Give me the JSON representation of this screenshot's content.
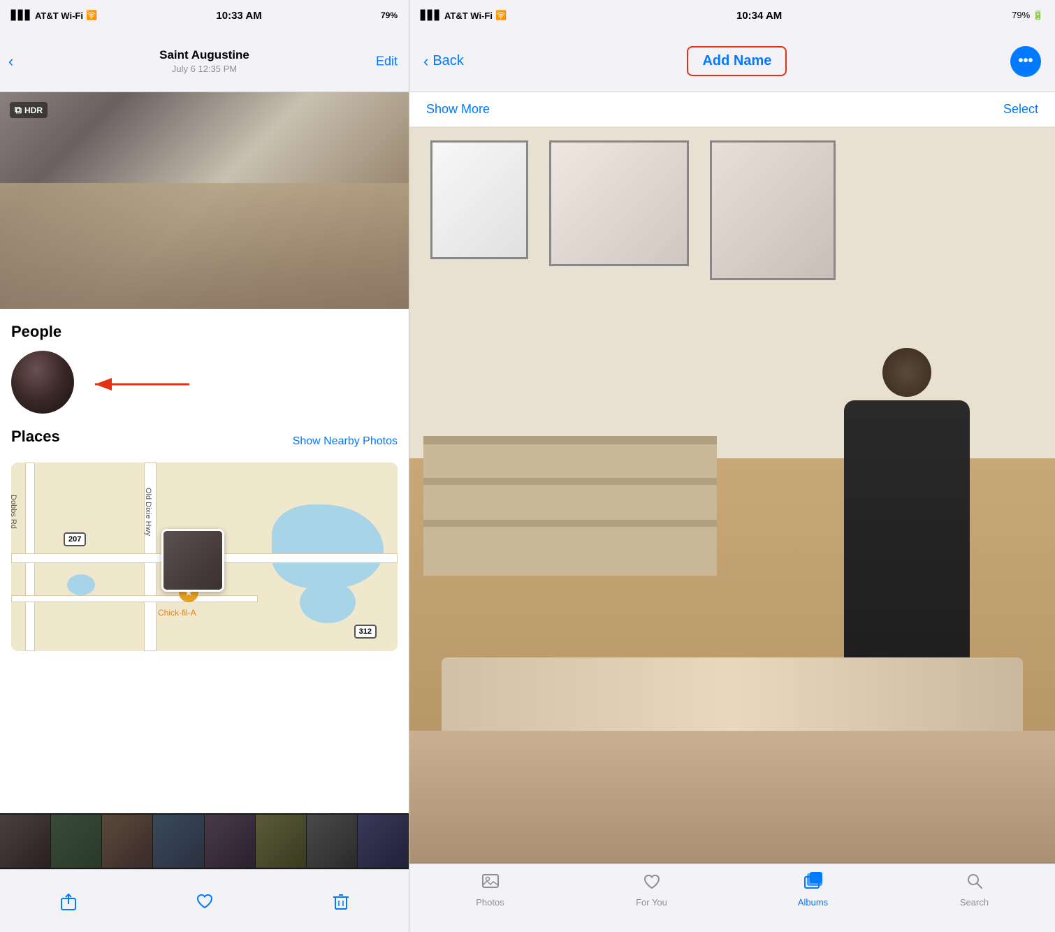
{
  "left": {
    "status_bar": {
      "carrier": "AT&T Wi-Fi",
      "time": "10:33 AM",
      "battery": "79%"
    },
    "nav": {
      "title": "Saint Augustine",
      "subtitle": "July 6  12:35 PM",
      "edit_label": "Edit",
      "back_icon": "‹"
    },
    "hdr_badge": "HDR",
    "sections": {
      "people_title": "People",
      "places_title": "Places",
      "show_nearby_label": "Show Nearby Photos"
    },
    "map": {
      "road_label_1": "Old Dixie Hwy",
      "road_label_2": "Dobbs Rd",
      "poi_label": "Chick-fil-A",
      "route_207": "207",
      "route_312": "312"
    },
    "action_bar": {
      "share_icon": "⬆",
      "heart_icon": "♡",
      "trash_icon": "🗑"
    }
  },
  "right": {
    "status_bar": {
      "carrier": "AT&T Wi-Fi",
      "time": "10:34 AM",
      "battery": "79%"
    },
    "nav": {
      "back_label": "Back",
      "add_name_label": "Add Name",
      "back_icon": "‹"
    },
    "toolbar": {
      "show_more_label": "Show More",
      "select_label": "Select"
    },
    "tab_bar": {
      "photos_label": "Photos",
      "for_you_label": "For You",
      "albums_label": "Albums",
      "search_label": "Search"
    }
  }
}
